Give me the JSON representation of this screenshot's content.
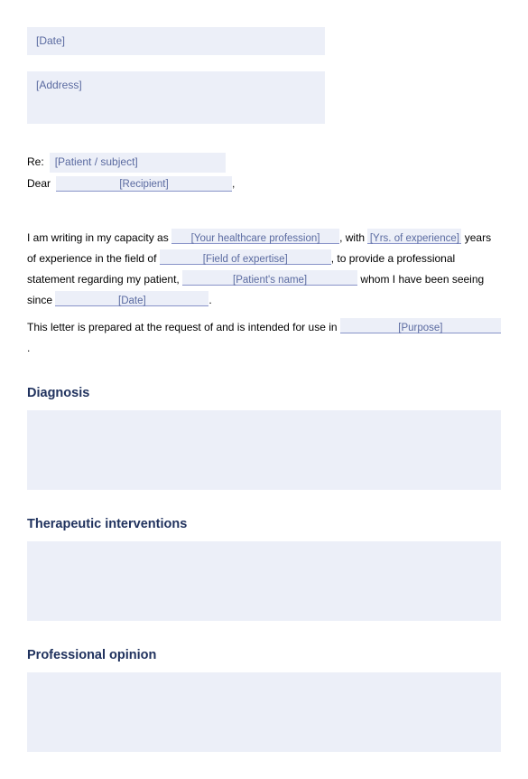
{
  "header": {
    "date_placeholder": "[Date]",
    "address_placeholder": "[Address]"
  },
  "re": {
    "label": "Re:",
    "patient_placeholder": "[Patient / subject]"
  },
  "dear": {
    "label": "Dear",
    "recipient_placeholder": "[Recipient]",
    "trailing": ","
  },
  "body": {
    "t1": "I am writing in my capacity as ",
    "profession_placeholder": "[Your healthcare profession]",
    "t2": ", with ",
    "experience_placeholder": "[Yrs. of experience]",
    "t3": " years of experience in the field of ",
    "field_placeholder": "[Field of expertise]",
    "t4": ", to provide a professional statement regarding  my  patient, ",
    "patient_name_placeholder": "[Patient's name]",
    "t5": " whom I have been seeing since ",
    "since_date_placeholder": "[Date]",
    "t6": "."
  },
  "purpose_para": {
    "t1": "This letter is prepared at the request of and is intended for use in ",
    "purpose_placeholder": "[Purpose]",
    "t2": "."
  },
  "sections": {
    "diagnosis": "Diagnosis",
    "therapeutic": "Therapeutic interventions",
    "opinion": "Professional opinion"
  }
}
